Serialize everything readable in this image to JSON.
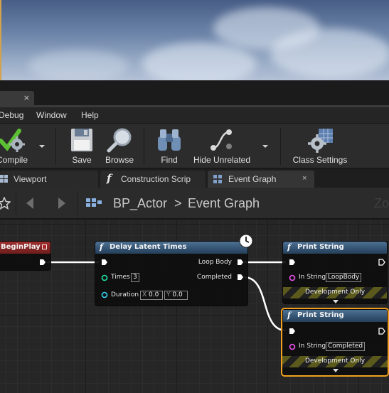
{
  "window": {
    "close_glyph": "×"
  },
  "menu": {
    "items": [
      "Debug",
      "Window",
      "Help"
    ]
  },
  "toolbar": {
    "compile_label": "Compile",
    "save_label": "Save",
    "browse_label": "Browse",
    "find_label": "Find",
    "hide_unrelated_label": "Hide Unrelated",
    "class_settings_label": "Class Settings"
  },
  "editor_tabs": [
    {
      "label": "Viewport",
      "icon": "viewport-icon"
    },
    {
      "label": "Construction Scrip",
      "icon": "function-icon"
    },
    {
      "label": "Event Graph",
      "icon": "graph-icon",
      "active": true,
      "close": "×"
    }
  ],
  "graph_header": {
    "breadcrumb_root": "BP_Actor",
    "separator": ">",
    "breadcrumb_current": "Event Graph",
    "zoom_label": "Zo"
  },
  "nodes": {
    "begin_play": {
      "title": "BeginPlay"
    },
    "delay": {
      "glyph": "f",
      "title": "Delay Latent Times",
      "pins": {
        "times_label": "Times",
        "times_value": "3",
        "duration_label": "Duration",
        "dur_x_label": "X",
        "dur_x_value": "0.0",
        "dur_y_label": "Y",
        "dur_y_value": "0.0",
        "loop_body": "Loop Body",
        "completed": "Completed"
      }
    },
    "print1": {
      "glyph": "f",
      "title": "Print String",
      "in_string_label": "In String",
      "in_string_value": "LoopBody",
      "dev_only": "Development Only"
    },
    "print2": {
      "glyph": "f",
      "title": "Print String",
      "in_string_label": "In String",
      "in_string_value": "Completed",
      "dev_only": "Development Only"
    }
  },
  "colors": {
    "accent_selected": "#f0a020",
    "node_header_blue": "#3a5b7c",
    "event_header_red": "#8e2727",
    "int_pin": "#1fe3a7",
    "float_pin": "#38d5f6",
    "string_pin": "#f050f0"
  }
}
